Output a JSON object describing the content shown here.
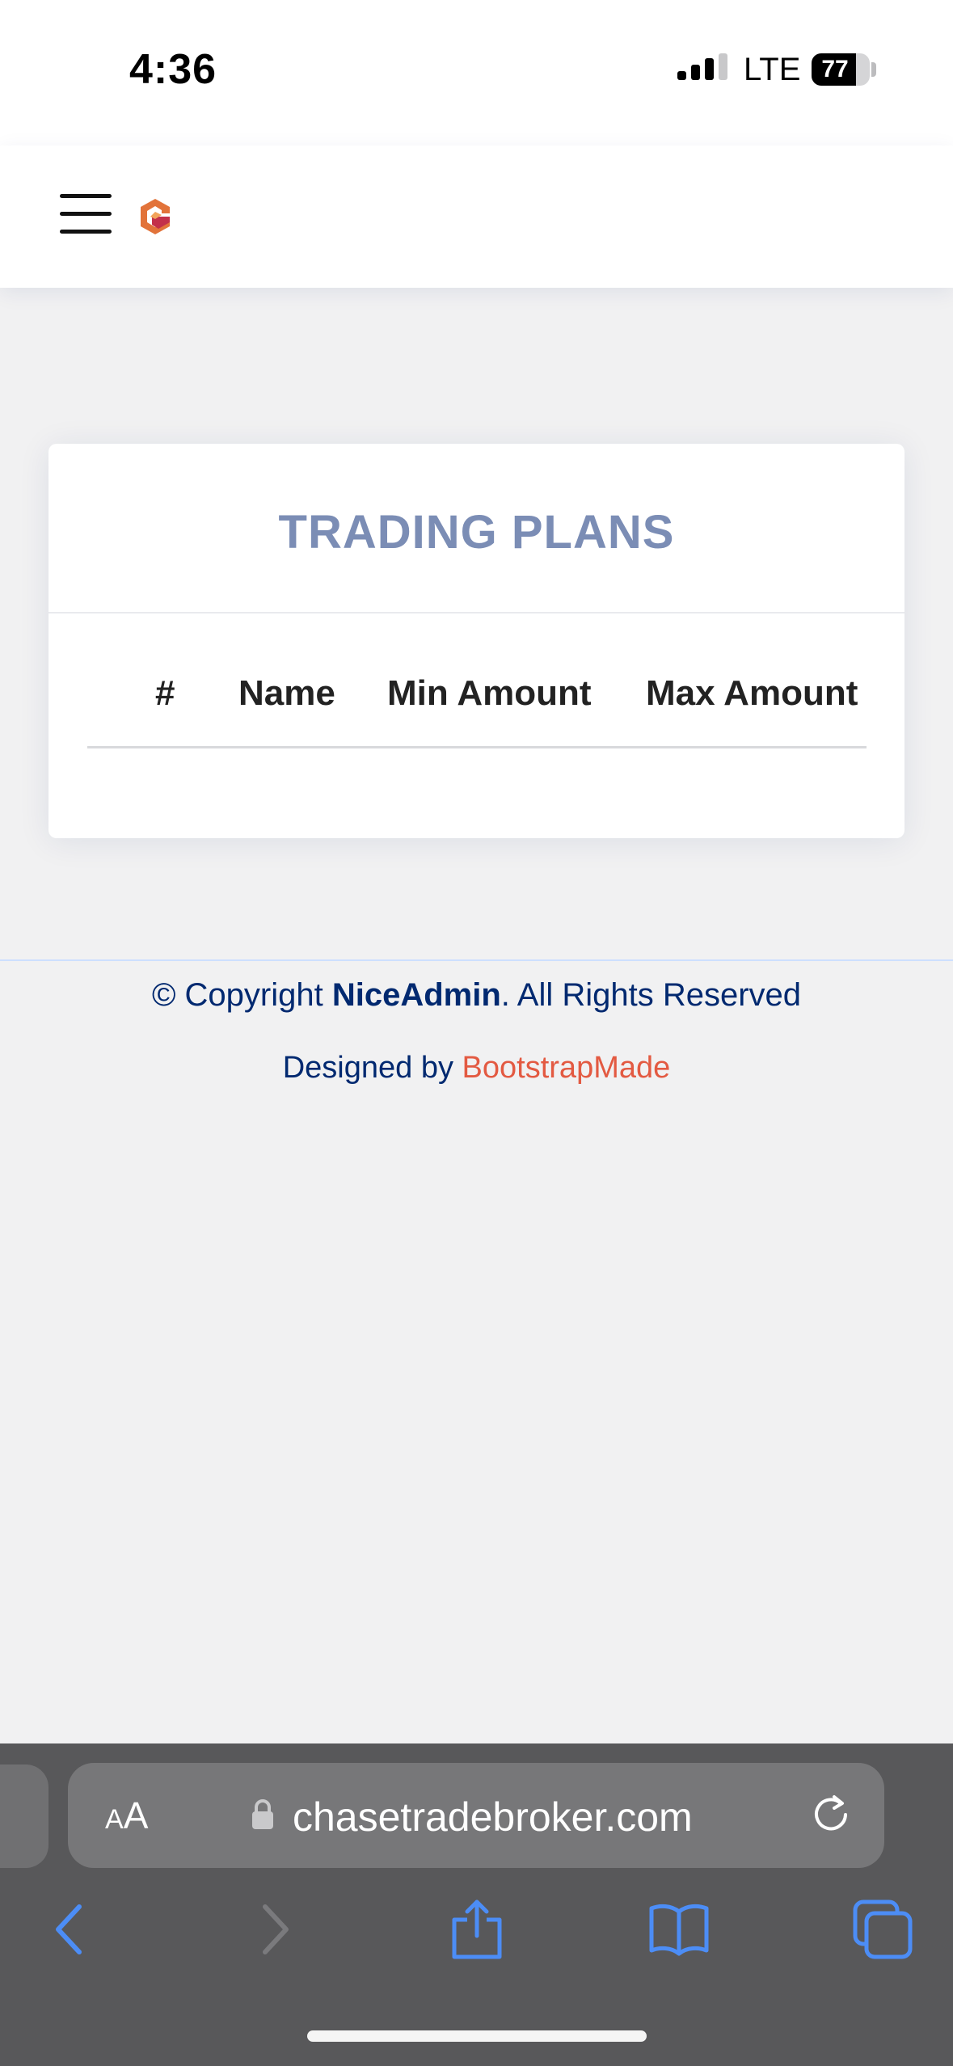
{
  "status_bar": {
    "time": "4:36",
    "network": "LTE",
    "battery_percent": 77,
    "battery_label": "77"
  },
  "header": {
    "menu_icon": "hamburger-menu-icon",
    "logo_icon": "brand-logo-icon"
  },
  "trading_plans": {
    "title": "TRADING PLANS",
    "columns": [
      "#",
      "Name",
      "Min Amount",
      "Max Amount"
    ],
    "rows": []
  },
  "footer": {
    "copyright_prefix": "© Copyright ",
    "brand": "NiceAdmin",
    "copyright_suffix": ". All Rights Reserved",
    "designed_by": "Designed by ",
    "designer": "BootstrapMade"
  },
  "browser": {
    "text_size_small": "A",
    "text_size_large": "A",
    "url": "chasetradebroker.com",
    "icons": {
      "lock": "lock-icon",
      "reload": "reload-icon",
      "back": "back-chevron-icon",
      "forward": "forward-chevron-icon",
      "share": "share-icon",
      "bookmarks": "bookmarks-icon",
      "tabs": "tabs-icon"
    }
  },
  "colors": {
    "card_title": "#7b8db5",
    "footer_text": "#012970",
    "designer_link": "#e35a42",
    "browser_accent": "#4c8df6"
  }
}
